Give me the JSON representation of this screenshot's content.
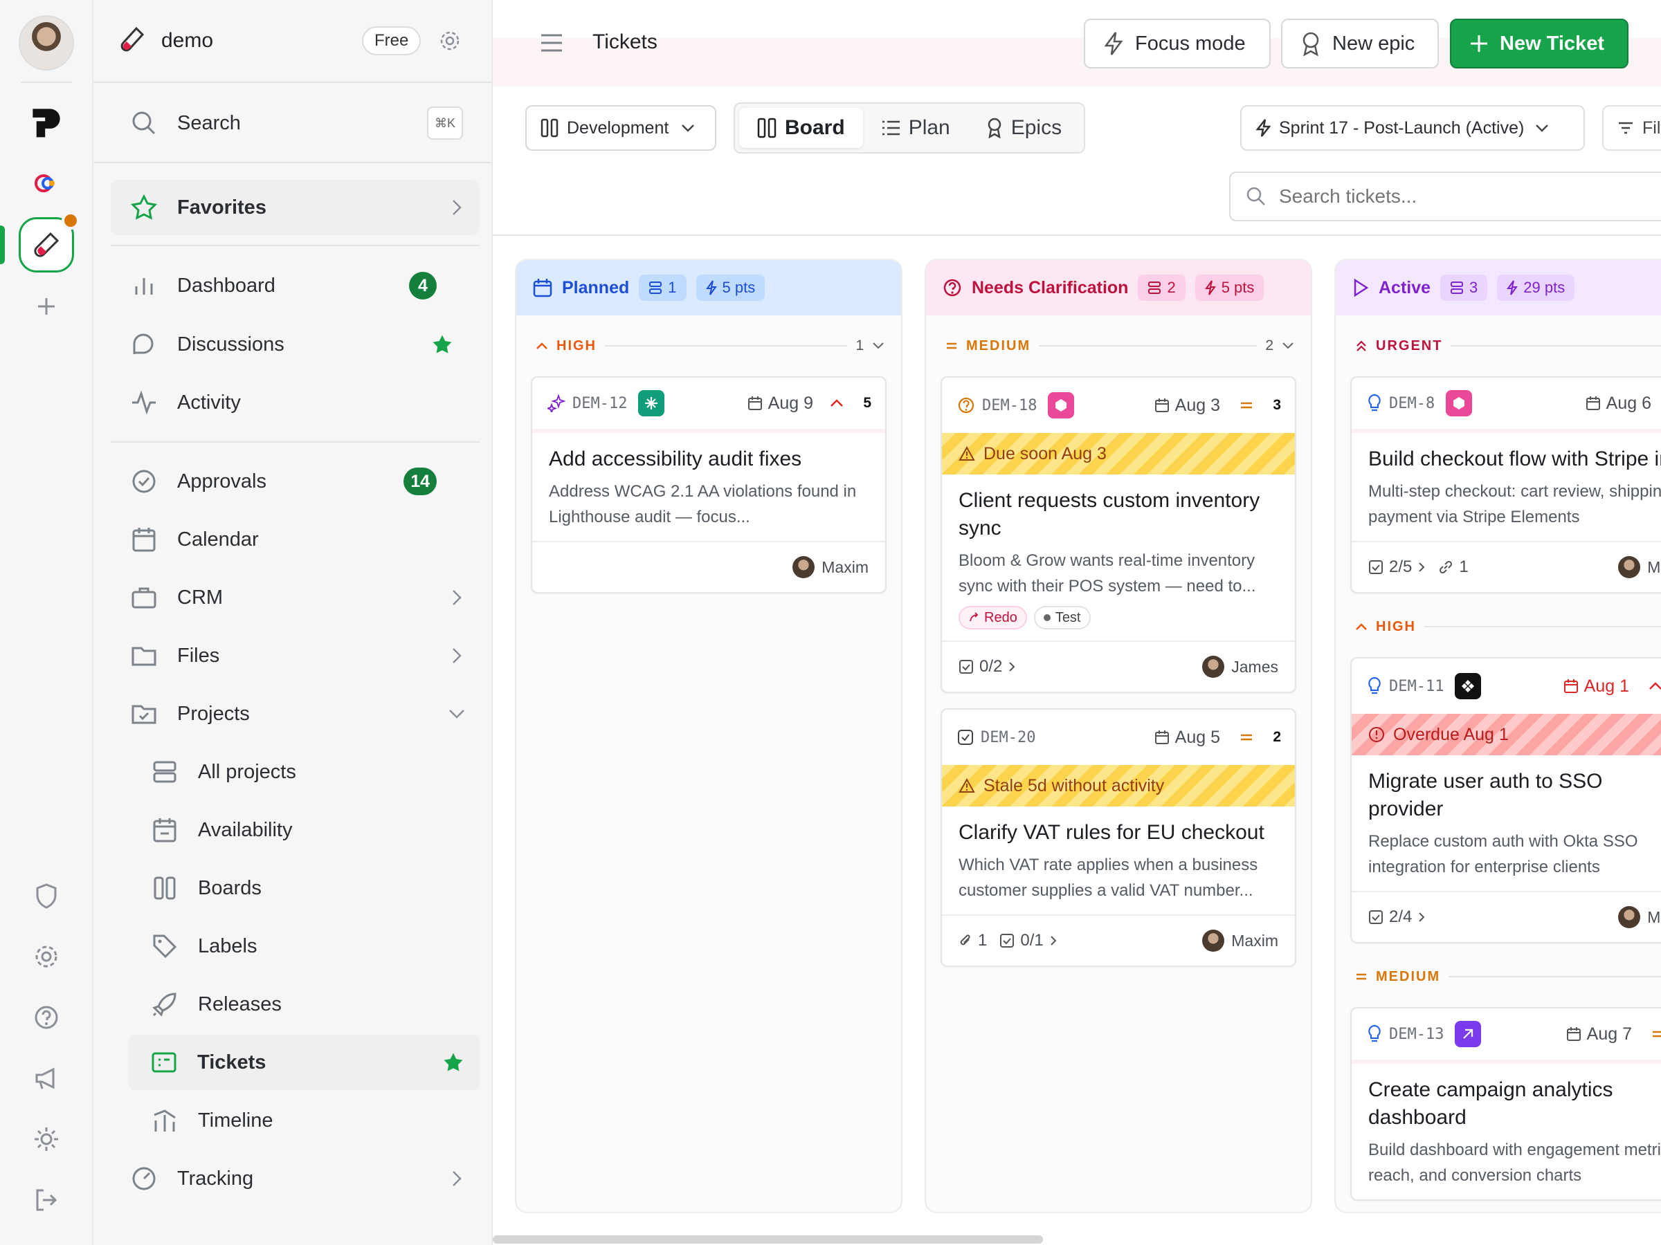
{
  "app": {
    "workspace_name": "demo",
    "plan_badge": "Free",
    "search_label": "Search",
    "search_shortcut": "⌘K"
  },
  "sidebar": {
    "favorites": "Favorites",
    "items": [
      {
        "label": "Dashboard",
        "badge": "4"
      },
      {
        "label": "Discussions"
      },
      {
        "label": "Activity"
      },
      {
        "label": "Approvals",
        "badge": "14"
      },
      {
        "label": "Calendar"
      },
      {
        "label": "CRM"
      },
      {
        "label": "Files"
      },
      {
        "label": "Projects"
      },
      {
        "label": "All projects"
      },
      {
        "label": "Availability"
      },
      {
        "label": "Boards"
      },
      {
        "label": "Labels"
      },
      {
        "label": "Releases"
      },
      {
        "label": "Tickets"
      },
      {
        "label": "Timeline"
      },
      {
        "label": "Tracking"
      }
    ]
  },
  "header": {
    "title": "Tickets",
    "focus_mode": "Focus mode",
    "new_epic": "New epic",
    "new_ticket": "New Ticket"
  },
  "toolbar": {
    "workspace_select": "Development",
    "views": [
      "Board",
      "Plan",
      "Epics"
    ],
    "active_view": "Board",
    "sprint_select": "Sprint 17 - Post-Launch (Active)",
    "filters": "Filters",
    "search_placeholder": "Search tickets..."
  },
  "columns": [
    {
      "name": "Planned",
      "count": "1",
      "points": "5 pts",
      "color": "#1d4ed8",
      "groups": [
        {
          "priority": "HIGH",
          "count": "1",
          "cards": [
            {
              "id": "DEM-12",
              "date": "Aug 9",
              "points": "5",
              "title": "Add accessibility audit fixes",
              "desc": "Address WCAG 2.1 AA violations found in Lighthouse audit — focus...",
              "assignee": "Maxim"
            }
          ]
        }
      ]
    },
    {
      "name": "Needs Clarification",
      "count": "2",
      "points": "5 pts",
      "color": "#be123c",
      "groups": [
        {
          "priority": "MEDIUM",
          "count": "2",
          "cards": [
            {
              "id": "DEM-18",
              "date": "Aug 3",
              "points": "3",
              "warning": "Due soon Aug 3",
              "title": "Client requests custom inventory sync",
              "desc": "Bloom & Grow wants real-time inventory sync with their POS system — need to...",
              "tags": [
                "Redo",
                "Test"
              ],
              "checklist": "0/2",
              "assignee": "James"
            },
            {
              "id": "DEM-20",
              "date": "Aug 5",
              "points": "2",
              "warning": "Stale 5d without activity",
              "title": "Clarify VAT rules for EU checkout",
              "desc": "Which VAT rate applies when a business customer supplies a valid VAT number...",
              "attachments": "1",
              "checklist": "0/1",
              "assignee": "Maxim"
            }
          ]
        }
      ]
    },
    {
      "name": "Active",
      "count": "3",
      "points": "29 pts",
      "color": "#7e22ce",
      "groups": [
        {
          "priority": "URGENT",
          "cards": [
            {
              "id": "DEM-8",
              "date": "Aug 6",
              "title": "Build checkout flow with Stripe integration",
              "desc": "Multi-step checkout: cart review, shipping, payment via Stripe Elements",
              "checklist": "2/5",
              "links": "1",
              "assignee": "Maxim"
            }
          ]
        },
        {
          "priority": "HIGH",
          "cards": [
            {
              "id": "DEM-11",
              "date": "Aug 1",
              "overdue": "Overdue Aug 1",
              "title": "Migrate user auth to SSO provider",
              "desc": "Replace custom auth with Okta SSO integration for enterprise clients",
              "checklist": "2/4",
              "assignee": "Maxim"
            }
          ]
        },
        {
          "priority": "MEDIUM",
          "cards": [
            {
              "id": "DEM-13",
              "date": "Aug 7",
              "title": "Create campaign analytics dashboard",
              "desc": "Build dashboard with engagement metrics, reach, and conversion charts"
            }
          ]
        }
      ]
    }
  ],
  "colors": {
    "accent_green": "#16a34a",
    "planned": "#1d4ed8",
    "needs_clarification": "#be123c",
    "active": "#7e22ce",
    "high": "#ea580c",
    "medium": "#d97706",
    "urgent": "#be123c"
  },
  "icons": [
    "hamburger-icon",
    "lightning-icon",
    "ribbon-icon",
    "plus-icon",
    "board-icon",
    "list-icon",
    "chevron-down-icon",
    "filter-icon",
    "search-icon",
    "calendar-icon",
    "star-icon",
    "gear-icon",
    "shield-icon",
    "help-icon",
    "megaphone-icon",
    "sun-icon",
    "logout-icon"
  ]
}
